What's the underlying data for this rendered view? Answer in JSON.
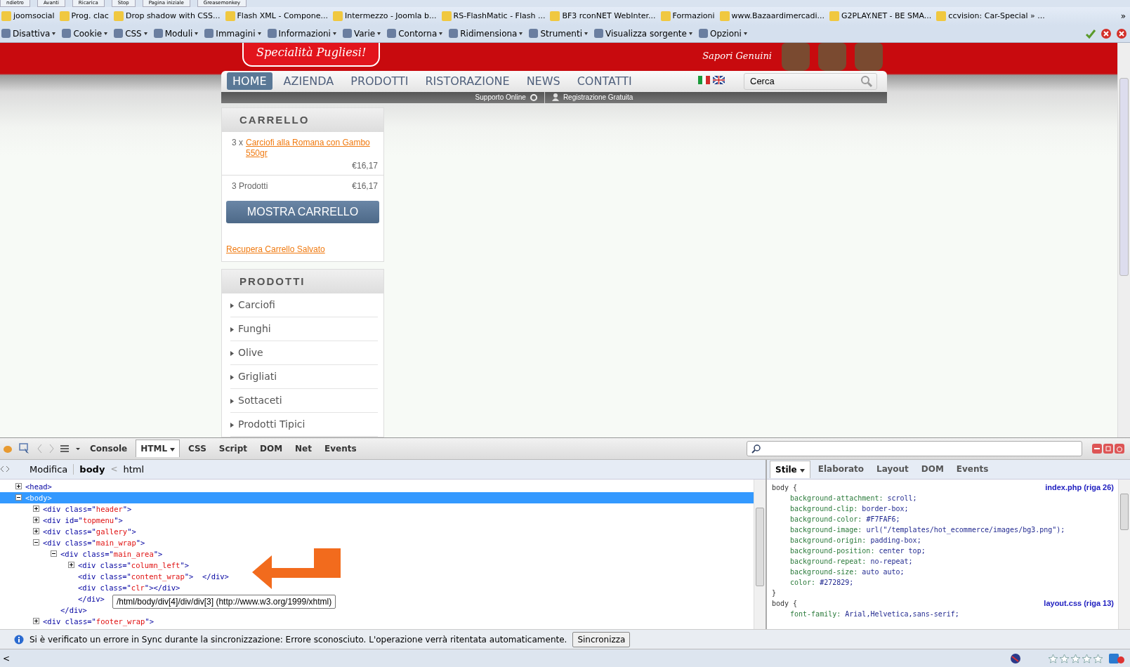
{
  "nav_buttons": [
    "ndietro",
    "Avanti",
    "Ricarica",
    "Stop",
    "Pagina iniziale",
    "Greasemonkey"
  ],
  "bookmarks": [
    "joomsocial",
    "Prog. clac",
    "Drop shadow with CSS...",
    "Flash XML - Compone...",
    "Intermezzo - Joomla b...",
    "RS-FlashMatic - Flash ...",
    "BF3 rconNET WebInter...",
    "Formazioni",
    "www.Bazaardimercadi...",
    "G2PLAY.NET - BE SMA...",
    "ccvision: Car-Special » ..."
  ],
  "bookmarks_more": "»",
  "webdev_toolbar": [
    "Disattiva",
    "Cookie",
    "CSS",
    "Moduli",
    "Immagini",
    "Informazioni",
    "Varie",
    "Contorna",
    "Ridimensiona",
    "Strumenti",
    "Visualizza sorgente",
    "Opzioni"
  ],
  "site": {
    "logo": "Specialità Pugliesi!",
    "tagline": [
      "Sapori Genuini"
    ],
    "menu": [
      {
        "label": "HOME",
        "selected": true
      },
      {
        "label": "AZIENDA",
        "selected": false
      },
      {
        "label": "PRODOTTI",
        "selected": false
      },
      {
        "label": "RISTORAZIONE",
        "selected": false
      },
      {
        "label": "NEWS",
        "selected": false
      },
      {
        "label": "CONTATTI",
        "selected": false
      }
    ],
    "search": {
      "value": "Cerca"
    },
    "subbar": [
      "Supporto Online",
      "Registrazione Gratuita"
    ],
    "cart": {
      "title": "CARRELLO",
      "qty": "3 x",
      "item": "Carciofi alla Romana con Gambo 550gr",
      "item_price": "€16,17",
      "total_label": "3 Prodotti",
      "total": "€16,17",
      "button": "MOSTRA CARRELLO",
      "restore_link": "Recupera Carrello Salvato"
    },
    "products": {
      "title": "PRODOTTI",
      "items": [
        "Carciofi",
        "Funghi",
        "Olive",
        "Grigliati",
        "Sottaceti",
        "Prodotti Tipici"
      ]
    }
  },
  "firebug": {
    "tabs": [
      {
        "label": "Console",
        "selected": false
      },
      {
        "label": "HTML",
        "selected": true
      },
      {
        "label": "CSS",
        "selected": false
      },
      {
        "label": "Script",
        "selected": false
      },
      {
        "label": "DOM",
        "selected": false
      },
      {
        "label": "Net",
        "selected": false
      },
      {
        "label": "Events",
        "selected": false
      }
    ],
    "edit_button": "Modifica",
    "breadcrumb": [
      "body",
      "<",
      "html"
    ],
    "tree": [
      {
        "kind": "node",
        "expanded": false,
        "selected": false,
        "segments": [
          {
            "t": "<head>",
            "kind": "tag"
          }
        ]
      },
      {
        "kind": "node",
        "expanded": true,
        "selected": true,
        "segments": [
          {
            "t": "<body>",
            "kind": "tag"
          }
        ],
        "children": [
          {
            "kind": "node",
            "expanded": false,
            "selected": false,
            "segments": [
              {
                "t": "<div class=\"",
                "kind": "tag"
              },
              {
                "t": "header",
                "kind": "value"
              },
              {
                "t": "\">",
                "kind": "tag"
              }
            ]
          },
          {
            "kind": "node",
            "expanded": false,
            "selected": false,
            "segments": [
              {
                "t": "<div id=\"",
                "kind": "tag"
              },
              {
                "t": "topmenu",
                "kind": "value"
              },
              {
                "t": "\">",
                "kind": "tag"
              }
            ]
          },
          {
            "kind": "node",
            "expanded": false,
            "selected": false,
            "segments": [
              {
                "t": "<div class=\"",
                "kind": "tag"
              },
              {
                "t": "gallery",
                "kind": "value"
              },
              {
                "t": "\">",
                "kind": "tag"
              }
            ]
          },
          {
            "kind": "node",
            "expanded": true,
            "selected": false,
            "segments": [
              {
                "t": "<div class=\"",
                "kind": "tag"
              },
              {
                "t": "main_wrap",
                "kind": "value"
              },
              {
                "t": "\">",
                "kind": "tag"
              }
            ],
            "children": [
              {
                "kind": "node",
                "expanded": true,
                "selected": false,
                "segments": [
                  {
                    "t": "<div class=\"",
                    "kind": "tag"
                  },
                  {
                    "t": "main_area",
                    "kind": "value"
                  },
                  {
                    "t": "\">",
                    "kind": "tag"
                  }
                ],
                "children": [
                  {
                    "kind": "node",
                    "expanded": false,
                    "selected": false,
                    "segments": [
                      {
                        "t": "<div class=\"",
                        "kind": "tag"
                      },
                      {
                        "t": "column_left",
                        "kind": "value"
                      },
                      {
                        "t": "\">",
                        "kind": "tag"
                      }
                    ]
                  },
                  {
                    "kind": "leaf",
                    "selected": false,
                    "segments": [
                      {
                        "t": "<div class=\"",
                        "kind": "tag"
                      },
                      {
                        "t": "content_wrap",
                        "kind": "value"
                      },
                      {
                        "t": "\">  </div>",
                        "kind": "tag"
                      }
                    ]
                  },
                  {
                    "kind": "leaf",
                    "selected": false,
                    "segments": [
                      {
                        "t": "<div class=\"",
                        "kind": "tag"
                      },
                      {
                        "t": "clr",
                        "kind": "value"
                      },
                      {
                        "t": "\"></div>",
                        "kind": "tag"
                      }
                    ]
                  },
                  {
                    "kind": "close",
                    "selected": false,
                    "segments": [
                      {
                        "t": "</div>",
                        "kind": "tag"
                      }
                    ]
                  }
                ]
              },
              {
                "kind": "close",
                "selected": false,
                "segments": [
                  {
                    "t": "</div>",
                    "kind": "tag"
                  }
                ]
              }
            ]
          },
          {
            "kind": "node",
            "expanded": false,
            "selected": false,
            "segments": [
              {
                "t": "<div class=\"",
                "kind": "tag"
              },
              {
                "t": "footer_wrap",
                "kind": "value"
              },
              {
                "t": "\">",
                "kind": "tag"
              }
            ]
          }
        ]
      }
    ],
    "tooltip": "/html/body/div[4]/div/div[3] (http://www.w3.org/1999/xhtml)",
    "side_tabs": [
      {
        "label": "Stile",
        "selected": true
      },
      {
        "label": "Elaborato",
        "selected": false
      },
      {
        "label": "Layout",
        "selected": false
      },
      {
        "label": "DOM",
        "selected": false
      },
      {
        "label": "Events",
        "selected": false
      }
    ],
    "rules": [
      {
        "selector": "body {",
        "source": "index.php (riga 26)",
        "close": "}",
        "props": [
          {
            "name": "background-attachment:",
            "value": "scroll;"
          },
          {
            "name": "background-clip:",
            "value": "border-box;"
          },
          {
            "name": "background-color:",
            "value": "#F7FAF6;"
          },
          {
            "name": "background-image:",
            "value": "url(\"/templates/hot_ecommerce/images/bg3.png\");"
          },
          {
            "name": "background-origin:",
            "value": "padding-box;"
          },
          {
            "name": "background-position:",
            "value": "center top;"
          },
          {
            "name": "background-repeat:",
            "value": "no-repeat;"
          },
          {
            "name": "background-size:",
            "value": "auto auto;"
          },
          {
            "name": "color:",
            "value": "#272829;"
          }
        ]
      },
      {
        "selector": "body {",
        "source": "layout.css (riga 13)",
        "props": [
          {
            "name": "font-family:",
            "value": "Arial,Helvetica,sans-serif;"
          }
        ]
      }
    ]
  },
  "notification": {
    "text": "Si è verificato un errore in Sync durante la sincronizzazione: Errore sconosciuto. L'operazione verrà ritentata automaticamente.",
    "button": "Sincronizza"
  },
  "status_bar": {
    "left": "<",
    "stars": 0
  }
}
